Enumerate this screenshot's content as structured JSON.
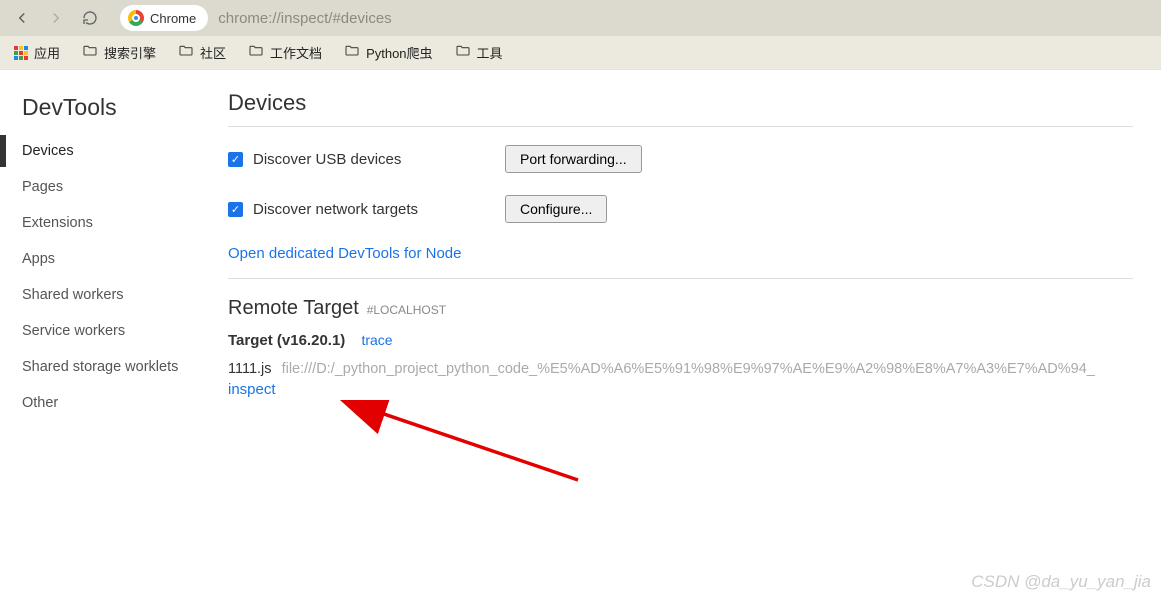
{
  "browser": {
    "chip_label": "Chrome",
    "url": "chrome://inspect/#devices"
  },
  "bookmarks": {
    "apps": "应用",
    "items": [
      "搜索引擎",
      "社区",
      "工作文档",
      "Python爬虫",
      "工具"
    ]
  },
  "sidebar": {
    "title": "DevTools",
    "items": [
      "Devices",
      "Pages",
      "Extensions",
      "Apps",
      "Shared workers",
      "Service workers",
      "Shared storage worklets",
      "Other"
    ],
    "active_index": 0
  },
  "devices": {
    "heading": "Devices",
    "usb_label": "Discover USB devices",
    "usb_checked": true,
    "port_fwd_btn": "Port forwarding...",
    "net_label": "Discover network targets",
    "net_checked": true,
    "configure_btn": "Configure...",
    "node_link": "Open dedicated DevTools for Node"
  },
  "remote": {
    "heading": "Remote Target",
    "tag": "#LOCALHOST",
    "target_label": "Target",
    "target_version": "(v16.20.1)",
    "trace": "trace",
    "file_name": "1111.js",
    "file_url": "file:///D:/_python_project_python_code_%E5%AD%A6%E5%91%98%E9%97%AE%E9%A2%98%E8%A7%A3%E7%AD%94_",
    "inspect": "inspect"
  },
  "watermark": "CSDN @da_yu_yan_jia"
}
